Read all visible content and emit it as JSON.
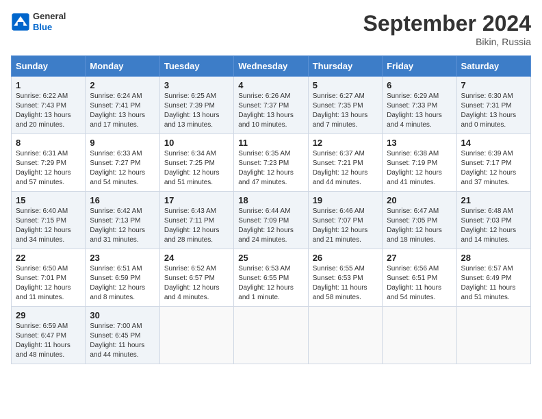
{
  "header": {
    "logo_line1": "General",
    "logo_line2": "Blue",
    "month_title": "September 2024",
    "location": "Bikin, Russia"
  },
  "days_of_week": [
    "Sunday",
    "Monday",
    "Tuesday",
    "Wednesday",
    "Thursday",
    "Friday",
    "Saturday"
  ],
  "weeks": [
    [
      {
        "day": "1",
        "sunrise": "6:22 AM",
        "sunset": "7:43 PM",
        "daylight": "13 hours and 20 minutes."
      },
      {
        "day": "2",
        "sunrise": "6:24 AM",
        "sunset": "7:41 PM",
        "daylight": "13 hours and 17 minutes."
      },
      {
        "day": "3",
        "sunrise": "6:25 AM",
        "sunset": "7:39 PM",
        "daylight": "13 hours and 13 minutes."
      },
      {
        "day": "4",
        "sunrise": "6:26 AM",
        "sunset": "7:37 PM",
        "daylight": "13 hours and 10 minutes."
      },
      {
        "day": "5",
        "sunrise": "6:27 AM",
        "sunset": "7:35 PM",
        "daylight": "13 hours and 7 minutes."
      },
      {
        "day": "6",
        "sunrise": "6:29 AM",
        "sunset": "7:33 PM",
        "daylight": "13 hours and 4 minutes."
      },
      {
        "day": "7",
        "sunrise": "6:30 AM",
        "sunset": "7:31 PM",
        "daylight": "13 hours and 0 minutes."
      }
    ],
    [
      {
        "day": "8",
        "sunrise": "6:31 AM",
        "sunset": "7:29 PM",
        "daylight": "12 hours and 57 minutes."
      },
      {
        "day": "9",
        "sunrise": "6:33 AM",
        "sunset": "7:27 PM",
        "daylight": "12 hours and 54 minutes."
      },
      {
        "day": "10",
        "sunrise": "6:34 AM",
        "sunset": "7:25 PM",
        "daylight": "12 hours and 51 minutes."
      },
      {
        "day": "11",
        "sunrise": "6:35 AM",
        "sunset": "7:23 PM",
        "daylight": "12 hours and 47 minutes."
      },
      {
        "day": "12",
        "sunrise": "6:37 AM",
        "sunset": "7:21 PM",
        "daylight": "12 hours and 44 minutes."
      },
      {
        "day": "13",
        "sunrise": "6:38 AM",
        "sunset": "7:19 PM",
        "daylight": "12 hours and 41 minutes."
      },
      {
        "day": "14",
        "sunrise": "6:39 AM",
        "sunset": "7:17 PM",
        "daylight": "12 hours and 37 minutes."
      }
    ],
    [
      {
        "day": "15",
        "sunrise": "6:40 AM",
        "sunset": "7:15 PM",
        "daylight": "12 hours and 34 minutes."
      },
      {
        "day": "16",
        "sunrise": "6:42 AM",
        "sunset": "7:13 PM",
        "daylight": "12 hours and 31 minutes."
      },
      {
        "day": "17",
        "sunrise": "6:43 AM",
        "sunset": "7:11 PM",
        "daylight": "12 hours and 28 minutes."
      },
      {
        "day": "18",
        "sunrise": "6:44 AM",
        "sunset": "7:09 PM",
        "daylight": "12 hours and 24 minutes."
      },
      {
        "day": "19",
        "sunrise": "6:46 AM",
        "sunset": "7:07 PM",
        "daylight": "12 hours and 21 minutes."
      },
      {
        "day": "20",
        "sunrise": "6:47 AM",
        "sunset": "7:05 PM",
        "daylight": "12 hours and 18 minutes."
      },
      {
        "day": "21",
        "sunrise": "6:48 AM",
        "sunset": "7:03 PM",
        "daylight": "12 hours and 14 minutes."
      }
    ],
    [
      {
        "day": "22",
        "sunrise": "6:50 AM",
        "sunset": "7:01 PM",
        "daylight": "12 hours and 11 minutes."
      },
      {
        "day": "23",
        "sunrise": "6:51 AM",
        "sunset": "6:59 PM",
        "daylight": "12 hours and 8 minutes."
      },
      {
        "day": "24",
        "sunrise": "6:52 AM",
        "sunset": "6:57 PM",
        "daylight": "12 hours and 4 minutes."
      },
      {
        "day": "25",
        "sunrise": "6:53 AM",
        "sunset": "6:55 PM",
        "daylight": "12 hours and 1 minute."
      },
      {
        "day": "26",
        "sunrise": "6:55 AM",
        "sunset": "6:53 PM",
        "daylight": "11 hours and 58 minutes."
      },
      {
        "day": "27",
        "sunrise": "6:56 AM",
        "sunset": "6:51 PM",
        "daylight": "11 hours and 54 minutes."
      },
      {
        "day": "28",
        "sunrise": "6:57 AM",
        "sunset": "6:49 PM",
        "daylight": "11 hours and 51 minutes."
      }
    ],
    [
      {
        "day": "29",
        "sunrise": "6:59 AM",
        "sunset": "6:47 PM",
        "daylight": "11 hours and 48 minutes."
      },
      {
        "day": "30",
        "sunrise": "7:00 AM",
        "sunset": "6:45 PM",
        "daylight": "11 hours and 44 minutes."
      },
      null,
      null,
      null,
      null,
      null
    ]
  ],
  "labels": {
    "sunrise": "Sunrise:",
    "sunset": "Sunset:",
    "daylight": "Daylight:"
  }
}
